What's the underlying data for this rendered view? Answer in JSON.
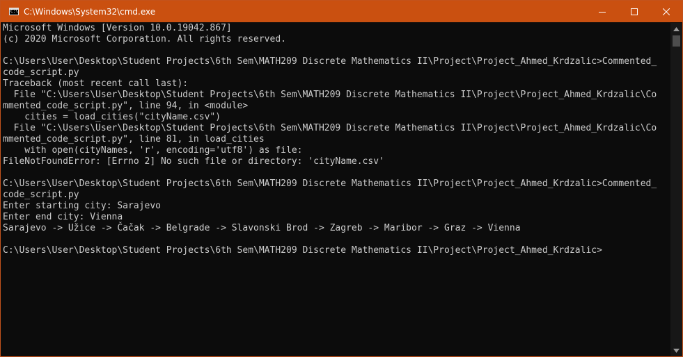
{
  "window": {
    "title": "C:\\Windows\\System32\\cmd.exe",
    "icon": "cmd-icon",
    "accent_color": "#ca5010"
  },
  "controls": {
    "minimize": "minimize-icon",
    "maximize": "maximize-icon",
    "close": "close-icon"
  },
  "console": {
    "lines": [
      "Microsoft Windows [Version 10.0.19042.867]",
      "(c) 2020 Microsoft Corporation. All rights reserved.",
      "",
      "C:\\Users\\User\\Desktop\\Student Projects\\6th Sem\\MATH209 Discrete Mathematics II\\Project\\Project_Ahmed_Krdzalic>Commented_",
      "code_script.py",
      "Traceback (most recent call last):",
      "  File \"C:\\Users\\User\\Desktop\\Student Projects\\6th Sem\\MATH209 Discrete Mathematics II\\Project\\Project_Ahmed_Krdzalic\\Co",
      "mmented_code_script.py\", line 94, in <module>",
      "    cities = load_cities(\"cityName.csv\")",
      "  File \"C:\\Users\\User\\Desktop\\Student Projects\\6th Sem\\MATH209 Discrete Mathematics II\\Project\\Project_Ahmed_Krdzalic\\Co",
      "mmented_code_script.py\", line 81, in load_cities",
      "    with open(cityNames, 'r', encoding='utf8') as file:",
      "FileNotFoundError: [Errno 2] No such file or directory: 'cityName.csv'",
      "",
      "C:\\Users\\User\\Desktop\\Student Projects\\6th Sem\\MATH209 Discrete Mathematics II\\Project\\Project_Ahmed_Krdzalic>Commented_",
      "code_script.py",
      "Enter starting city: Sarajevo",
      "Enter end city: Vienna",
      "Sarajevo -> Užice -> Čačak -> Belgrade -> Slavonski Brod -> Zagreb -> Maribor -> Graz -> Vienna",
      "",
      "C:\\Users\\User\\Desktop\\Student Projects\\6th Sem\\MATH209 Discrete Mathematics II\\Project\\Project_Ahmed_Krdzalic>"
    ]
  },
  "scrollbar": {
    "up": "scroll-up-arrow-icon",
    "down": "scroll-down-arrow-icon"
  }
}
